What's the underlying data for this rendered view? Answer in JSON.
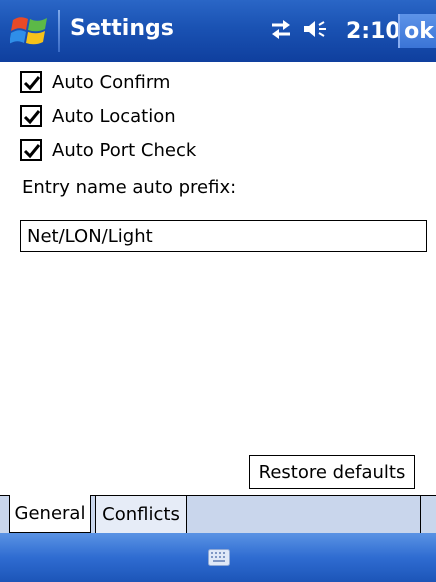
{
  "titlebar": {
    "title": "Settings",
    "clock": "2:10",
    "ok_label": "ok",
    "start_icon": "windows-flag-icon",
    "status_icons": [
      "connectivity-icon",
      "speaker-icon"
    ]
  },
  "options": [
    {
      "label": "Auto Confirm",
      "checked": true
    },
    {
      "label": "Auto Location",
      "checked": true
    },
    {
      "label": "Auto Port Check",
      "checked": true
    }
  ],
  "prefix": {
    "label": "Entry name auto prefix:",
    "value": "Net/LON/Light"
  },
  "restore_label": "Restore defaults",
  "tabs": [
    {
      "label": "General",
      "active": true
    },
    {
      "label": "Conflicts",
      "active": false
    }
  ],
  "menubar": {
    "sip_icon": "keyboard-icon"
  },
  "colors": {
    "titlebar": "#1a52b3",
    "menubar": "#2f6cd1",
    "tabstrip": "#c9d6ec"
  }
}
